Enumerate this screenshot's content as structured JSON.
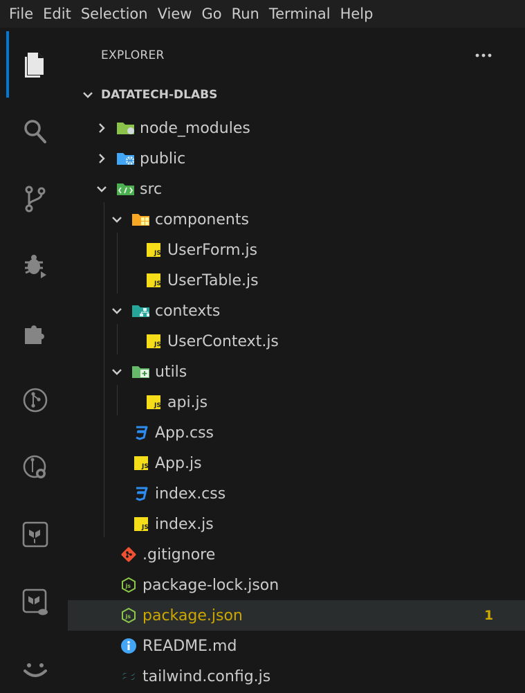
{
  "menu": [
    "File",
    "Edit",
    "Selection",
    "View",
    "Go",
    "Run",
    "Terminal",
    "Help"
  ],
  "activity_bar": [
    {
      "icon": "files-icon",
      "active": true
    },
    {
      "icon": "search-icon"
    },
    {
      "icon": "source-control-icon"
    },
    {
      "icon": "run-debug-icon"
    },
    {
      "icon": "extensions-icon"
    },
    {
      "icon": "git-graph-icon"
    },
    {
      "icon": "git-history-icon"
    },
    {
      "icon": "terraform-icon"
    },
    {
      "icon": "terraform-cloud-icon"
    },
    {
      "icon": "feedback-smiley-icon"
    }
  ],
  "explorer": {
    "title": "EXPLORER",
    "more_label": "•••",
    "root": "DATATECH-DLABS",
    "tree": [
      {
        "label": "node_modules",
        "type": "folder",
        "icon": "folder-node-icon",
        "expanded": false
      },
      {
        "label": "public",
        "type": "folder",
        "icon": "folder-public-icon",
        "expanded": false
      },
      {
        "label": "src",
        "type": "folder",
        "icon": "folder-src-icon",
        "expanded": true
      },
      {
        "label": "components",
        "type": "folder",
        "icon": "folder-components-icon",
        "expanded": true
      },
      {
        "label": "UserForm.js",
        "type": "file",
        "icon": "js-file-icon"
      },
      {
        "label": "UserTable.js",
        "type": "file",
        "icon": "js-file-icon"
      },
      {
        "label": "contexts",
        "type": "folder",
        "icon": "folder-contexts-icon",
        "expanded": true
      },
      {
        "label": "UserContext.js",
        "type": "file",
        "icon": "js-file-icon"
      },
      {
        "label": "utils",
        "type": "folder",
        "icon": "folder-utils-icon",
        "expanded": true
      },
      {
        "label": "api.js",
        "type": "file",
        "icon": "js-file-icon"
      },
      {
        "label": "App.css",
        "type": "file",
        "icon": "css-file-icon"
      },
      {
        "label": "App.js",
        "type": "file",
        "icon": "js-file-icon"
      },
      {
        "label": "index.css",
        "type": "file",
        "icon": "css-file-icon"
      },
      {
        "label": "index.js",
        "type": "file",
        "icon": "js-file-icon"
      },
      {
        "label": ".gitignore",
        "type": "file",
        "icon": "git-file-icon"
      },
      {
        "label": "package-lock.json",
        "type": "file",
        "icon": "node-json-file-icon"
      },
      {
        "label": "package.json",
        "type": "file",
        "icon": "node-json-file-icon",
        "selected": true,
        "modified": true,
        "badge": "1"
      },
      {
        "label": "README.md",
        "type": "file",
        "icon": "info-file-icon"
      },
      {
        "label": "tailwind.config.js",
        "type": "file",
        "icon": "tailwind-file-icon"
      }
    ]
  },
  "colors": {
    "background": "#181818",
    "menubar": "#1f1f1f",
    "accent": "#0078d4",
    "selected_row": "#2a2d2e",
    "modified": "#cca700",
    "js": "#f5de19",
    "css": "#2d8cf0",
    "git": "#f05133",
    "node_json": "#8cc84b"
  }
}
